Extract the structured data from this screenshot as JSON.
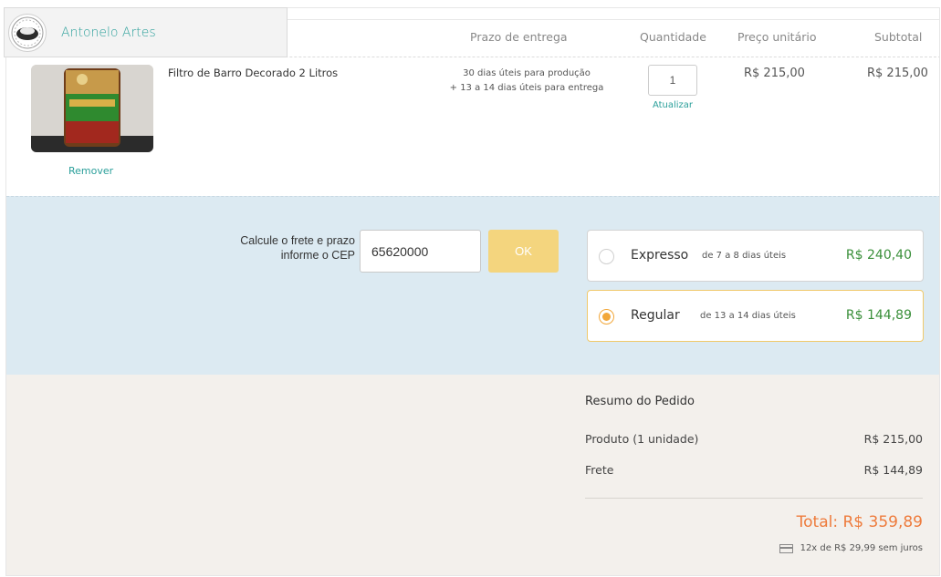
{
  "store": {
    "name": "Antonelo Artes"
  },
  "table": {
    "headers": {
      "prazo": "Prazo de entrega",
      "quantidade": "Quantidade",
      "preco_unitario": "Preço unitário",
      "subtotal": "Subtotal"
    }
  },
  "item": {
    "name": "Filtro de Barro Decorado 2 Litros",
    "remove_label": "Remover",
    "prazo_line1": "30 dias úteis para produção",
    "prazo_line2": "+ 13 a 14 dias úteis para entrega",
    "quantity": "1",
    "update_label": "Atualizar",
    "unit_price": "R$ 215,00",
    "subtotal": "R$ 215,00"
  },
  "shipping": {
    "label_line1": "Calcule o frete e prazo",
    "label_line2": "informe o CEP",
    "cep_value": "65620000",
    "ok_label": "OK",
    "options": [
      {
        "name": "Expresso",
        "days": "de 7 a 8 dias úteis",
        "price": "R$ 240,40",
        "selected": false
      },
      {
        "name": "Regular",
        "days": "de 13 a 14 dias úteis",
        "price": "R$ 144,89",
        "selected": true
      }
    ]
  },
  "summary": {
    "title": "Resumo do Pedido",
    "produto_label": "Produto (1 unidade)",
    "produto_value": "R$ 215,00",
    "frete_label": "Frete",
    "frete_value": "R$ 144,89",
    "total": "Total: R$ 359,89",
    "installments": "12x de R$ 29,99 sem juros"
  },
  "colors": {
    "accent": "#2a9f9a",
    "ok_button": "#f4d57e",
    "total": "#ee7b3c",
    "price_green": "#3a8f3a",
    "shipping_bg": "#dceaf2",
    "summary_bg": "#f3f0ec"
  }
}
